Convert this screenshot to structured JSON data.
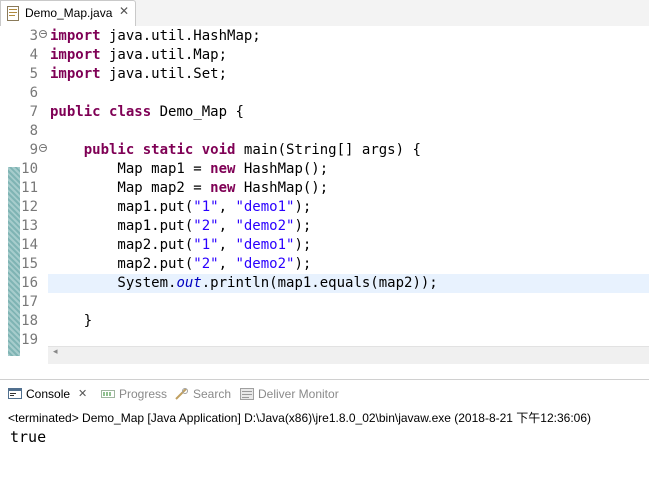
{
  "editor": {
    "tab": {
      "label": "Demo_Map.java",
      "close_glyph": "✕"
    },
    "lines": [
      {
        "n": "3",
        "fold": "⊖",
        "tokens": [
          [
            "kw",
            "import"
          ],
          [
            "",
            " java.util.HashMap;"
          ]
        ]
      },
      {
        "n": "4",
        "fold": "",
        "tokens": [
          [
            "kw",
            "import"
          ],
          [
            "",
            " java.util.Map;"
          ]
        ]
      },
      {
        "n": "5",
        "fold": "",
        "tokens": [
          [
            "kw",
            "import"
          ],
          [
            "",
            " java.util.Set;"
          ]
        ]
      },
      {
        "n": "6",
        "fold": "",
        "tokens": []
      },
      {
        "n": "7",
        "fold": "",
        "tokens": [
          [
            "kw",
            "public"
          ],
          [
            "",
            " "
          ],
          [
            "kw",
            "class"
          ],
          [
            "",
            " Demo_Map {"
          ]
        ]
      },
      {
        "n": "8",
        "fold": "",
        "tokens": []
      },
      {
        "n": "9",
        "fold": "⊖",
        "tokens": [
          [
            "",
            "    "
          ],
          [
            "kw",
            "public"
          ],
          [
            "",
            " "
          ],
          [
            "kw",
            "static"
          ],
          [
            "",
            " "
          ],
          [
            "kw",
            "void"
          ],
          [
            "",
            " main(String[] args) {"
          ]
        ]
      },
      {
        "n": "10",
        "fold": "",
        "tokens": [
          [
            "",
            "        Map map1 = "
          ],
          [
            "kw",
            "new"
          ],
          [
            "",
            " HashMap();"
          ]
        ]
      },
      {
        "n": "11",
        "fold": "",
        "tokens": [
          [
            "",
            "        Map map2 = "
          ],
          [
            "kw",
            "new"
          ],
          [
            "",
            " HashMap();"
          ]
        ]
      },
      {
        "n": "12",
        "fold": "",
        "tokens": [
          [
            "",
            "        map1.put("
          ],
          [
            "str",
            "\"1\""
          ],
          [
            "",
            ", "
          ],
          [
            "str",
            "\"demo1\""
          ],
          [
            "",
            ");"
          ]
        ]
      },
      {
        "n": "13",
        "fold": "",
        "tokens": [
          [
            "",
            "        map1.put("
          ],
          [
            "str",
            "\"2\""
          ],
          [
            "",
            ", "
          ],
          [
            "str",
            "\"demo2\""
          ],
          [
            "",
            ");"
          ]
        ]
      },
      {
        "n": "14",
        "fold": "",
        "tokens": [
          [
            "",
            "        map2.put("
          ],
          [
            "str",
            "\"1\""
          ],
          [
            "",
            ", "
          ],
          [
            "str",
            "\"demo1\""
          ],
          [
            "",
            ");"
          ]
        ]
      },
      {
        "n": "15",
        "fold": "",
        "tokens": [
          [
            "",
            "        map2.put("
          ],
          [
            "str",
            "\"2\""
          ],
          [
            "",
            ", "
          ],
          [
            "str",
            "\"demo2\""
          ],
          [
            "",
            ");"
          ]
        ]
      },
      {
        "n": "16",
        "fold": "",
        "tokens": [
          [
            "",
            "        System."
          ],
          [
            "fld",
            "out"
          ],
          [
            "",
            ".println(map1.equals(map2));"
          ]
        ],
        "current": true
      },
      {
        "n": "17",
        "fold": "",
        "tokens": []
      },
      {
        "n": "18",
        "fold": "",
        "tokens": [
          [
            "",
            "    }"
          ]
        ]
      },
      {
        "n": "19",
        "fold": "",
        "tokens": []
      }
    ],
    "scroll_left_glyph": "◂"
  },
  "views": {
    "tabs": [
      {
        "name": "tab-console",
        "label": "Console",
        "active": true,
        "icon": "console-icon"
      },
      {
        "name": "tab-progress",
        "label": "Progress",
        "active": false,
        "icon": "progress-icon"
      },
      {
        "name": "tab-search",
        "label": "Search",
        "active": false,
        "icon": "search-icon"
      },
      {
        "name": "tab-deliver-monitor",
        "label": "Deliver Monitor",
        "active": false,
        "icon": "deliver-monitor-icon"
      }
    ],
    "close_glyph": "✕"
  },
  "console": {
    "status": "<terminated> Demo_Map [Java Application] D:\\Java(x86)\\jre1.8.0_02\\bin\\javaw.exe (2018-8-21 下午12:36:06)",
    "output": "true"
  },
  "colors": {
    "keyword": "#7f0055",
    "string": "#2a00ff",
    "static_field": "#0000c0",
    "current_line": "#e8f2fe",
    "line_number": "#787878"
  }
}
